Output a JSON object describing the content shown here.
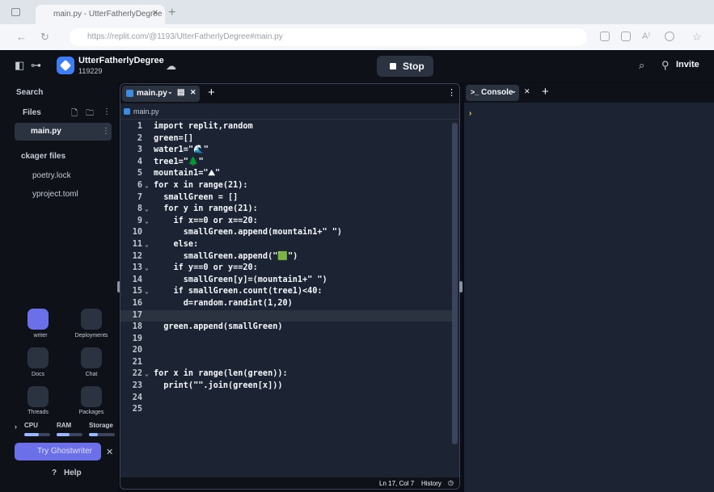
{
  "browser": {
    "tab_title": "main.py - UtterFatherlyDegree",
    "url": "https://replit.com/@1193/UtterFatherlyDegree#main.py"
  },
  "header": {
    "repl_name": "UtterFatherlyDegree",
    "repl_id": "119229",
    "stop_label": "Stop",
    "invite_label": "Invite"
  },
  "sidebar": {
    "search_label": "Search",
    "files_label": "Files",
    "active_file": "main.py",
    "packager_label": "ckager files",
    "poetry_lock": "poetry.lock",
    "pyproject": "yproject.toml",
    "tools": {
      "ghostwriter": "writer",
      "deployments": "Deployments",
      "docs": "Docs",
      "chat": "Chat",
      "threads": "Threads",
      "packages": "Packages"
    },
    "meters": {
      "cpu_label": "CPU",
      "ram_label": "RAM",
      "storage_label": "Storage",
      "cpu_level": 0.55,
      "ram_level": 0.5,
      "storage_level": 0.35
    },
    "ghostwriter_button": "Try Ghostwriter",
    "help_label": "Help"
  },
  "editor": {
    "tab_label": "main.py",
    "breadcrumb": "main.py",
    "status_position": "Ln 17, Col 7",
    "history_label": "History",
    "lines": [
      {
        "n": "1",
        "fold": "",
        "text": "import replit,random"
      },
      {
        "n": "2",
        "fold": "",
        "text": "green=[]"
      },
      {
        "n": "3",
        "fold": "",
        "text": "water1=\"🌊\""
      },
      {
        "n": "4",
        "fold": "",
        "text": "tree1=\"🌲\""
      },
      {
        "n": "5",
        "fold": "",
        "text": "mountain1=\"⛰\""
      },
      {
        "n": "6",
        "fold": "⌄",
        "text": "for x in range(21):"
      },
      {
        "n": "7",
        "fold": "",
        "text": "  smallGreen = []"
      },
      {
        "n": "8",
        "fold": "⌄",
        "text": "  for y in range(21):"
      },
      {
        "n": "9",
        "fold": "⌄",
        "text": "    if x==0 or x==20:"
      },
      {
        "n": "10",
        "fold": "",
        "text": "      smallGreen.append(mountain1+\" \")"
      },
      {
        "n": "11",
        "fold": "⌄",
        "text": "    else:"
      },
      {
        "n": "12",
        "fold": "",
        "text": "      smallGreen.append(\"🟩\")"
      },
      {
        "n": "13",
        "fold": "⌄",
        "text": "    if y==0 or y==20:"
      },
      {
        "n": "14",
        "fold": "",
        "text": "      smallGreen[y]=(mountain1+\" \")"
      },
      {
        "n": "15",
        "fold": "⌄",
        "text": "    if smallGreen.count(tree1)<40:"
      },
      {
        "n": "16",
        "fold": "",
        "text": "      d=random.randint(1,20)"
      },
      {
        "n": "17",
        "fold": "",
        "text": ""
      },
      {
        "n": "18",
        "fold": "",
        "text": "  green.append(smallGreen)"
      },
      {
        "n": "19",
        "fold": "",
        "text": ""
      },
      {
        "n": "20",
        "fold": "",
        "text": ""
      },
      {
        "n": "21",
        "fold": "",
        "text": ""
      },
      {
        "n": "22",
        "fold": "⌄",
        "text": "for x in range(len(green)):"
      },
      {
        "n": "23",
        "fold": "",
        "text": "  print(\"\".join(green[x]))"
      },
      {
        "n": "24",
        "fold": "",
        "text": ""
      },
      {
        "n": "25",
        "fold": "",
        "text": ""
      }
    ]
  },
  "console": {
    "tab_label": "Console",
    "prompt": "›"
  },
  "colors": {
    "background": "#0e1118",
    "editor_bg": "#1c2333",
    "accent": "#3d7df5",
    "ghostwriter": "#6b6fe8",
    "prompt": "#f0d040"
  }
}
